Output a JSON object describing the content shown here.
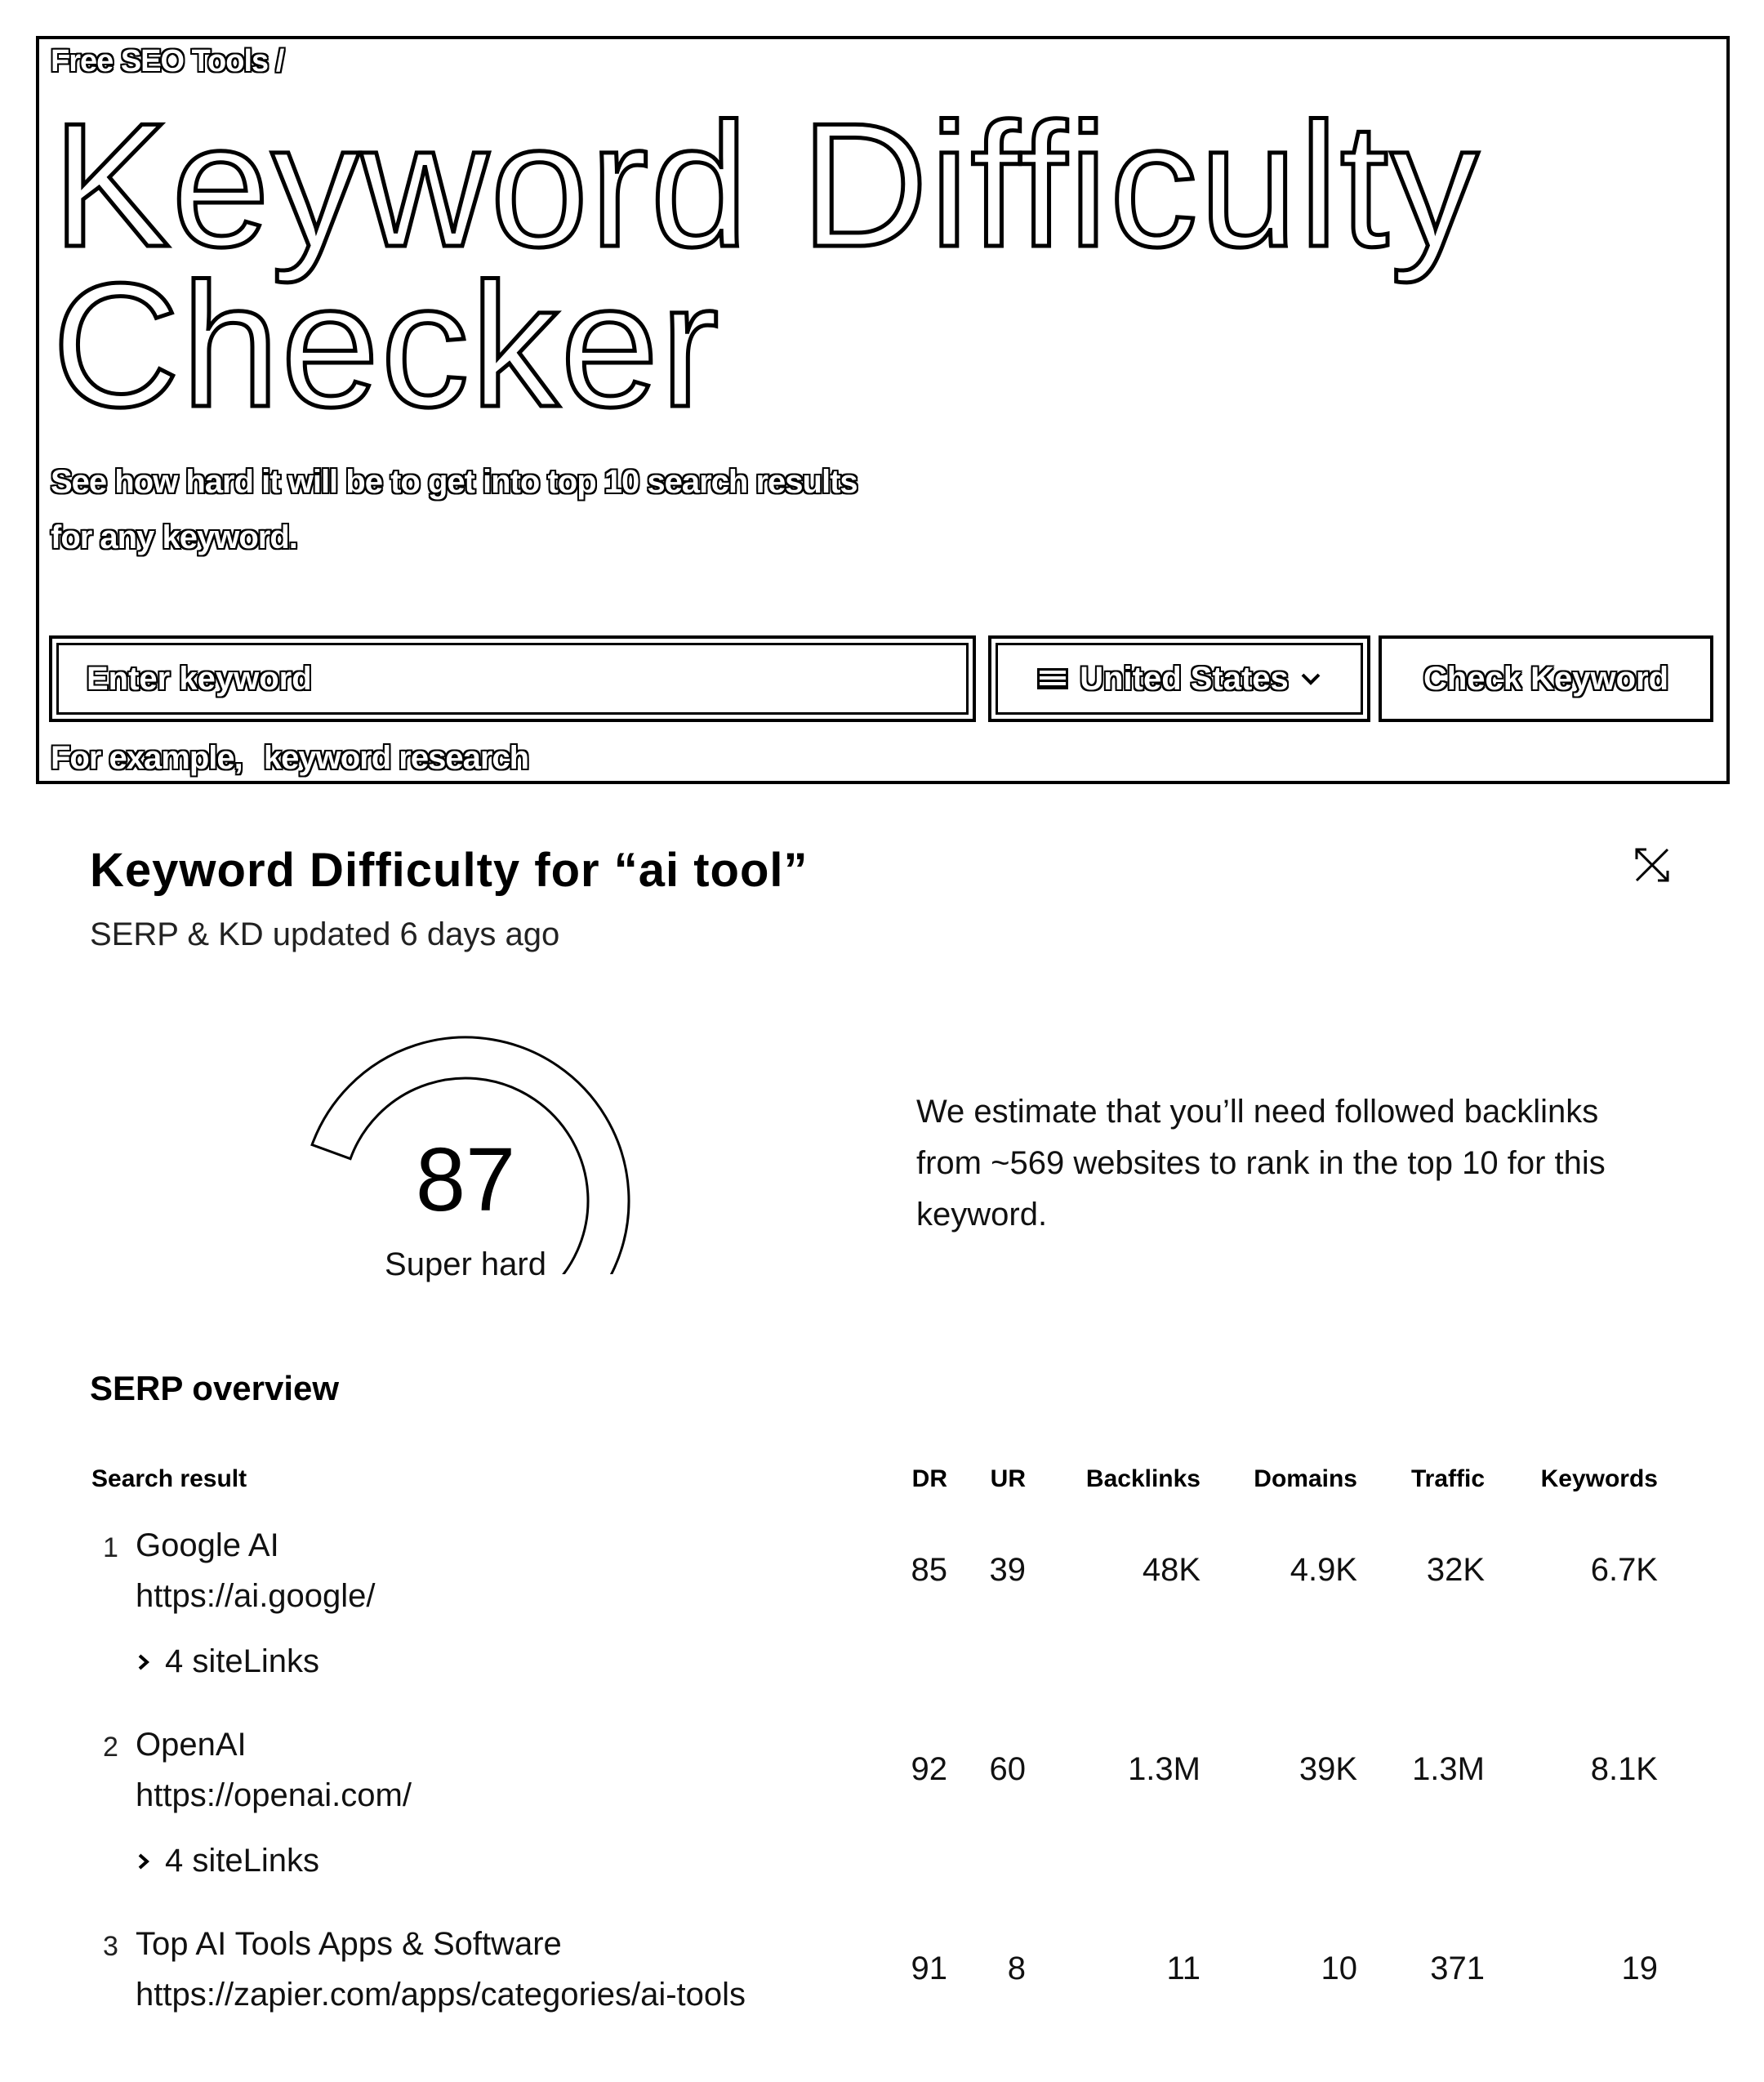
{
  "hero": {
    "breadcrumb": "Free SEO Tools /",
    "title_line1": "Keyword Difficulty",
    "title_line2": "Checker",
    "subtitle_line1": "See how hard it will be to get into top 10 search results",
    "subtitle_line2": "for any keyword.",
    "input_placeholder": "Enter keyword",
    "country": "United States",
    "country_flag_icon": "flag-icon",
    "check_button": "Check Keyword",
    "example_prefix": "For example,",
    "example_link": "keyword research"
  },
  "results": {
    "title": "Keyword Difficulty for “ai tool”",
    "updated": "SERP & KD updated 6 days ago",
    "close_icon": "close-icon",
    "kd_value": "87",
    "kd_label": "Super hard",
    "kd_fraction": 0.87,
    "estimate_line1": "We estimate that you’ll need followed backlinks",
    "estimate_line2": "from ~569 websites to rank in the top 10 for this",
    "estimate_line3": "keyword.",
    "serp_heading": "SERP overview",
    "columns": {
      "result": "Search result",
      "dr": "DR",
      "ur": "UR",
      "backlinks": "Backlinks",
      "domains": "Domains",
      "traffic": "Traffic",
      "keywords": "Keywords"
    },
    "rows": [
      {
        "rank": "1",
        "title": "Google AI",
        "url": "https://ai.google/",
        "sitelinks": "4 siteLinks",
        "dr": "85",
        "ur": "39",
        "backlinks": "48K",
        "domains": "4.9K",
        "traffic": "32K",
        "keywords": "6.7K"
      },
      {
        "rank": "2",
        "title": "OpenAI",
        "url": "https://openai.com/",
        "sitelinks": "4 siteLinks",
        "dr": "92",
        "ur": "60",
        "backlinks": "1.3M",
        "domains": "39K",
        "traffic": "1.3M",
        "keywords": "8.1K"
      },
      {
        "rank": "3",
        "title": "Top AI Tools Apps & Software",
        "url": "https://zapier.com/apps/categories/ai-tools",
        "sitelinks": "",
        "dr": "91",
        "ur": "8",
        "backlinks": "11",
        "domains": "10",
        "traffic": "371",
        "keywords": "19"
      }
    ]
  }
}
